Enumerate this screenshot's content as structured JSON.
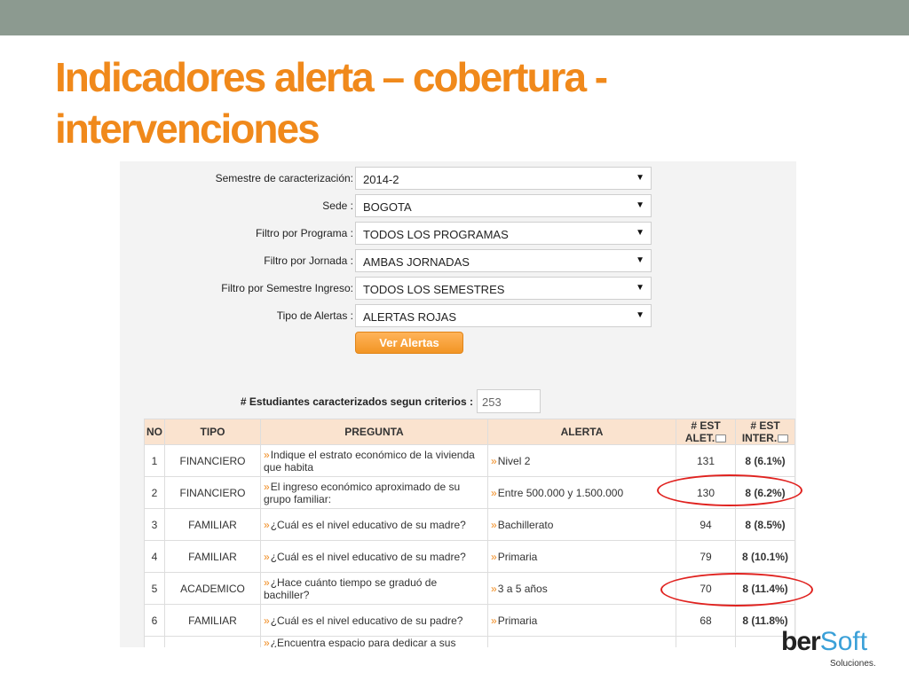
{
  "slide": {
    "title": "Indicadores alerta – cobertura - intervenciones"
  },
  "filters": [
    {
      "label": "Semestre de caracterización:",
      "value": "2014-2"
    },
    {
      "label": "Sede :",
      "value": "BOGOTA"
    },
    {
      "label": "Filtro por Programa :",
      "value": "TODOS LOS PROGRAMAS"
    },
    {
      "label": "Filtro por Jornada :",
      "value": "AMBAS JORNADAS"
    },
    {
      "label": "Filtro por Semestre Ingreso:",
      "value": "TODOS LOS SEMESTRES"
    },
    {
      "label": "Tipo de Alertas :",
      "value": "ALERTAS ROJAS"
    }
  ],
  "button": {
    "label": "Ver Alertas"
  },
  "count": {
    "label": "# Estudiantes caracterizados segun criterios :",
    "value": "253"
  },
  "table": {
    "headers": {
      "no": "NO",
      "tipo": "TIPO",
      "pregunta": "PREGUNTA",
      "alerta": "ALERTA",
      "est_alet": "# EST ALET.",
      "est_inter": "# EST INTER."
    },
    "rows": [
      {
        "no": "1",
        "tipo": "FINANCIERO",
        "pregunta": "Indique el estrato económico de la vivienda que habita",
        "alerta": "Nivel 2",
        "est_alet": "131",
        "est_inter": "8 (6.1%)"
      },
      {
        "no": "2",
        "tipo": "FINANCIERO",
        "pregunta": "El ingreso económico aproximado de su grupo familiar:",
        "alerta": "Entre 500.000 y 1.500.000",
        "est_alet": "130",
        "est_inter": "8 (6.2%)"
      },
      {
        "no": "3",
        "tipo": "FAMILIAR",
        "pregunta": "¿Cuál es el nivel educativo de su madre?",
        "alerta": "Bachillerato",
        "est_alet": "94",
        "est_inter": "8 (8.5%)"
      },
      {
        "no": "4",
        "tipo": "FAMILIAR",
        "pregunta": "¿Cuál es el nivel educativo de su madre?",
        "alerta": "Primaria",
        "est_alet": "79",
        "est_inter": "8 (10.1%)"
      },
      {
        "no": "5",
        "tipo": "ACADEMICO",
        "pregunta": "¿Hace cuánto tiempo se graduó de bachiller?",
        "alerta": "3 a 5 años",
        "est_alet": "70",
        "est_inter": "8 (11.4%)"
      },
      {
        "no": "6",
        "tipo": "FAMILIAR",
        "pregunta": "¿Cuál es el nivel educativo de su padre?",
        "alerta": "Primaria",
        "est_alet": "68",
        "est_inter": "8 (11.8%)"
      },
      {
        "no": "",
        "tipo": "",
        "pregunta": "¿Encuentra espacio para dedicar a sus",
        "alerta": "",
        "est_alet": "",
        "est_inter": ""
      }
    ]
  },
  "logo": {
    "ber": "ber",
    "soft": "Soft",
    "sub": "Soluciones."
  },
  "colors": {
    "title": "#f0891b",
    "topbar": "#8c9a90",
    "highlight": "#e0221f",
    "header_bg": "#fae3cf"
  }
}
